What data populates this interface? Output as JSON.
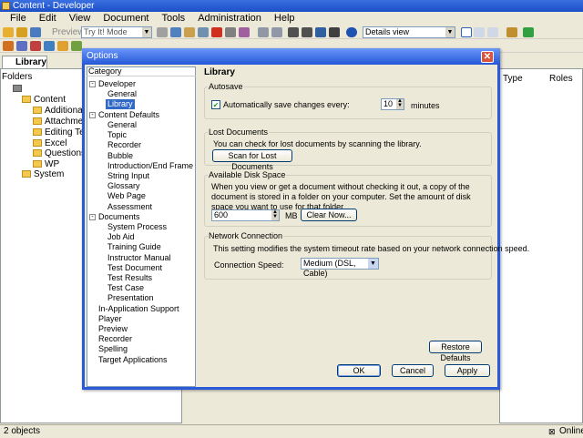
{
  "app": {
    "title": "Content - Developer"
  },
  "menu": [
    "File",
    "Edit",
    "View",
    "Document",
    "Tools",
    "Administration",
    "Help"
  ],
  "toolbar": {
    "preview_label": "Preview",
    "mode_value": "Try It! Mode",
    "view_value": "Details view"
  },
  "library_tab": {
    "label": "Library"
  },
  "folders": {
    "header": "Folders",
    "items": [
      "Content",
      "Additional Top",
      "Attachments",
      "Editing Techni",
      "Excel",
      "Questions an",
      "WP",
      "System"
    ]
  },
  "right_columns": {
    "type": "Type",
    "roles": "Roles"
  },
  "status": {
    "count": "2 objects",
    "state": "Online"
  },
  "dialog": {
    "title": "Options",
    "category_header": "Category",
    "categories": [
      {
        "label": "Developer",
        "expander": "-"
      },
      {
        "label": "General"
      },
      {
        "label": "Library"
      },
      {
        "label": "Content Defaults",
        "expander": "-"
      },
      {
        "label": "General"
      },
      {
        "label": "Topic"
      },
      {
        "label": "Recorder"
      },
      {
        "label": "Bubble"
      },
      {
        "label": "Introduction/End Frame"
      },
      {
        "label": "String Input"
      },
      {
        "label": "Glossary"
      },
      {
        "label": "Web Page"
      },
      {
        "label": "Assessment"
      },
      {
        "label": "Documents",
        "expander": "-"
      },
      {
        "label": "System Process"
      },
      {
        "label": "Job Aid"
      },
      {
        "label": "Training Guide"
      },
      {
        "label": "Instructor Manual"
      },
      {
        "label": "Test Document"
      },
      {
        "label": "Test Results"
      },
      {
        "label": "Test Case"
      },
      {
        "label": "Presentation"
      },
      {
        "label": "In-Application Support"
      },
      {
        "label": "Player"
      },
      {
        "label": "Preview"
      },
      {
        "label": "Recorder"
      },
      {
        "label": "Spelling"
      },
      {
        "label": "Target Applications"
      }
    ],
    "panel_title": "Library",
    "autosave": {
      "group": "Autosave",
      "checkbox_label": "Automatically save changes every:",
      "checked": true,
      "minutes_value": "10",
      "unit": "minutes"
    },
    "lost": {
      "group": "Lost Documents",
      "text": "You can check for lost documents by scanning the library.",
      "button": "Scan for Lost Documents"
    },
    "disk": {
      "group": "Available Disk Space",
      "text": "When you view or get a document without checking it out, a copy of the document is stored in a folder on your computer. Set the amount of disk space you want to use for that folder.",
      "value": "600",
      "unit": "MB",
      "button": "Clear Now..."
    },
    "network": {
      "group": "Network Connection",
      "text": "This setting modifies the system timeout rate based on your network connection speed.",
      "speed_label": "Connection Speed:",
      "speed_value": "Medium (DSL, Cable)"
    },
    "restore_button": "Restore Defaults",
    "ok_button": "OK",
    "cancel_button": "Cancel",
    "apply_button": "Apply"
  }
}
